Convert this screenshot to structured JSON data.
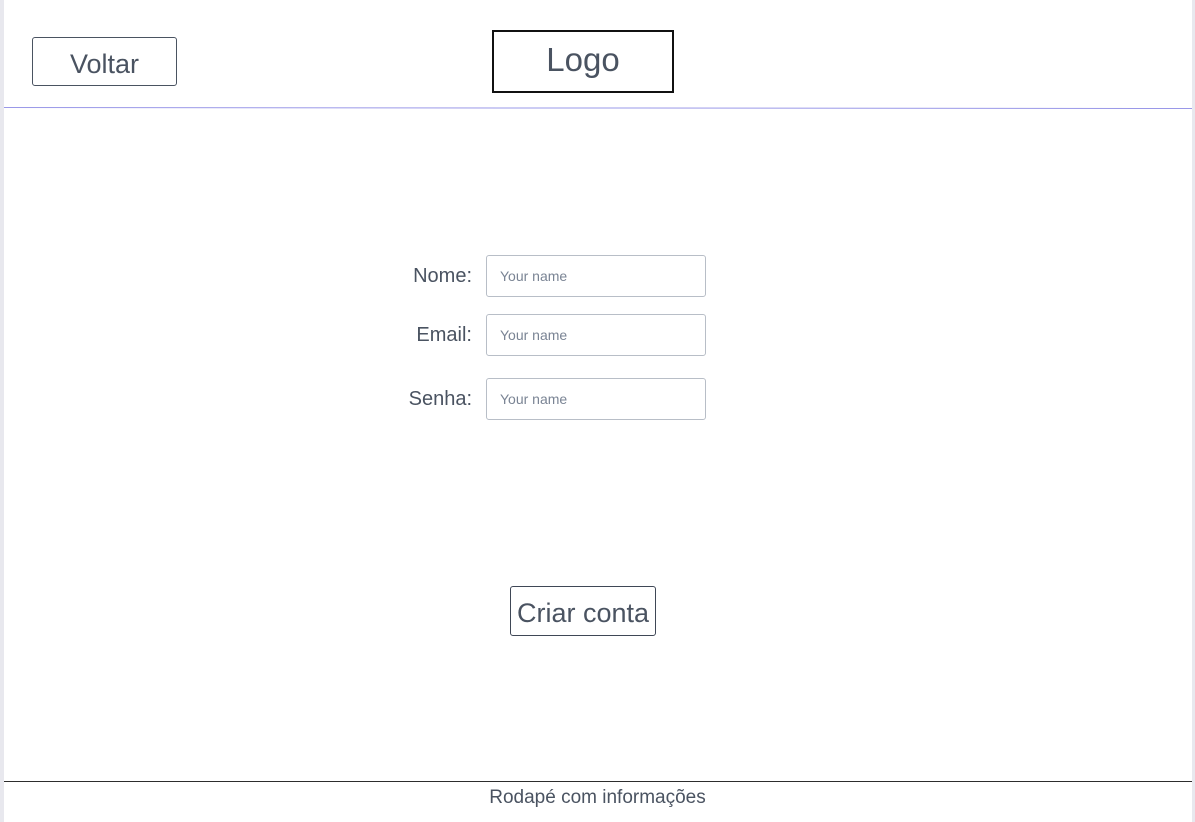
{
  "header": {
    "back_label": "Voltar",
    "logo_text": "Logo"
  },
  "form": {
    "fields": [
      {
        "label": "Nome:",
        "placeholder": "Your name",
        "value": ""
      },
      {
        "label": "Email:",
        "placeholder": "Your name",
        "value": ""
      },
      {
        "label": "Senha:",
        "placeholder": "Your name",
        "value": ""
      }
    ],
    "submit_label": "Criar conta"
  },
  "footer": {
    "text": "Rodapé com informações"
  },
  "colors": {
    "header_divider": "#9a98e8",
    "footer_divider": "#2d2d2d",
    "text": "#4a5361"
  }
}
